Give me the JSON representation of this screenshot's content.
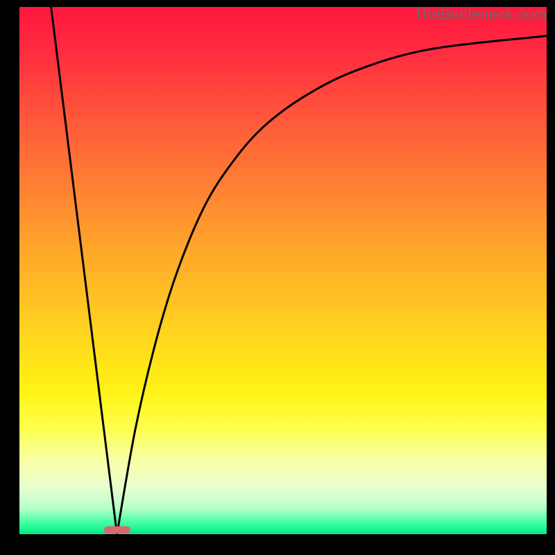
{
  "watermark": "TheBottleneck.com",
  "marker": {
    "x_pct": 18.5,
    "y_pct": 99.2
  },
  "chart_data": {
    "type": "line",
    "title": "",
    "xlabel": "",
    "ylabel": "",
    "xlim": [
      0,
      100
    ],
    "ylim": [
      0,
      100
    ],
    "series": [
      {
        "name": "left-segment",
        "x": [
          6,
          18.5
        ],
        "y": [
          100,
          0
        ]
      },
      {
        "name": "right-curve",
        "x": [
          18.5,
          22,
          26,
          30,
          35,
          40,
          46,
          54,
          64,
          78,
          100
        ],
        "y": [
          0,
          20,
          37,
          50,
          62,
          70,
          77,
          83,
          88,
          92,
          94.5
        ]
      }
    ],
    "annotations": [
      {
        "type": "marker",
        "x": 18.5,
        "y": 0,
        "shape": "pill",
        "color": "#d56b6e"
      }
    ],
    "background_gradient": {
      "top": "#ff173f",
      "bottom": "#00e885"
    }
  }
}
